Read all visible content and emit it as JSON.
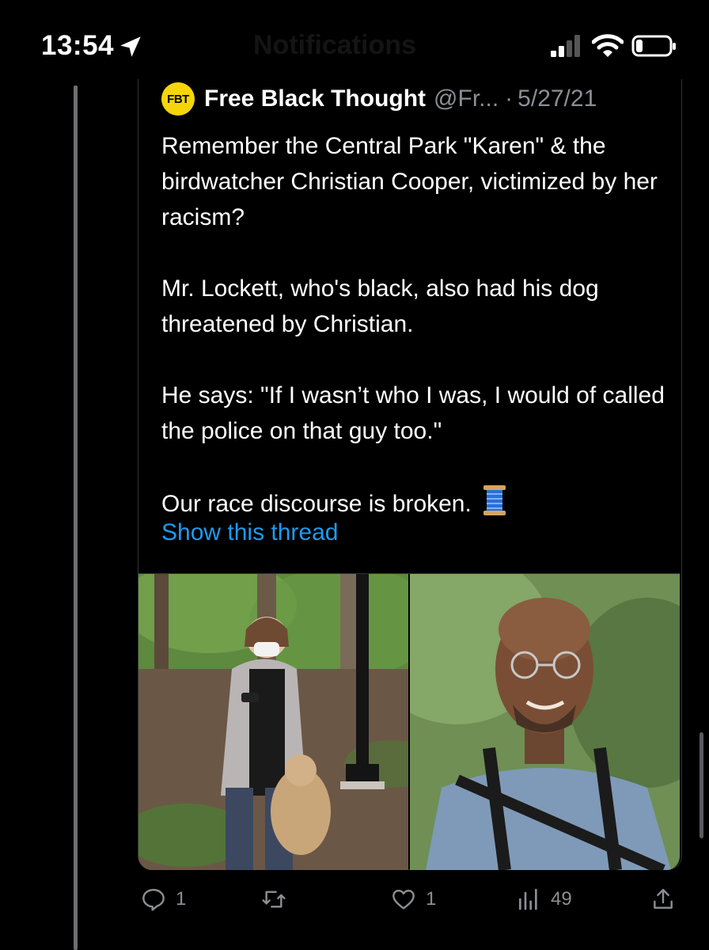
{
  "status_bar": {
    "time": "13:54",
    "ghost_title": "Notifications"
  },
  "quoted_tweet": {
    "avatar_text": "FBT",
    "author": "Free Black Thought",
    "handle": "@Fr...",
    "separator": "·",
    "date": "5/27/21",
    "paragraphs": [
      "Remember the Central Park \"Karen\" & the birdwatcher Christian Cooper, victimized by her racism?",
      "Mr. Lockett, who's black, also had his dog threatened by Christian.",
      "He says: \"If I wasn’t who I was, I would of called the police on that guy too.\"",
      "Our race discourse is broken."
    ],
    "emoji": "spool-of-thread",
    "show_thread": "Show this thread",
    "images": [
      "woman-with-dog-in-park-photo",
      "man-with-glasses-outdoors-photo"
    ]
  },
  "actions": {
    "replies": "1",
    "retweets": "",
    "likes": "1",
    "views": "49"
  },
  "colors": {
    "background": "#000000",
    "accent": "#1d9bf0",
    "secondary_text": "#8b8f94",
    "avatar_bg": "#f5d50a"
  }
}
